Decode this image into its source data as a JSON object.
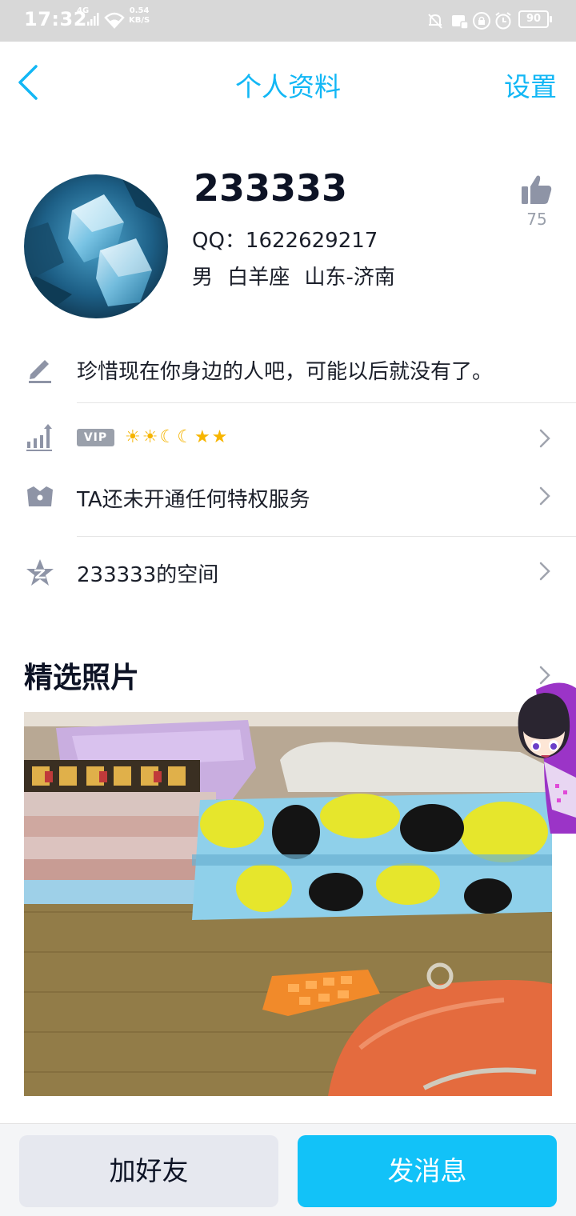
{
  "status_bar": {
    "time": "17:32",
    "network": "4G",
    "speed_value": "0.54",
    "speed_unit": "KB/S",
    "battery": "90",
    "icons": [
      "signal-icon",
      "wifi-icon",
      "mute-icon",
      "sim-icon",
      "lock-icon",
      "alarm-icon",
      "battery-icon"
    ]
  },
  "header": {
    "title": "个人资料",
    "settings_label": "设置",
    "back_icon": "chevron-left-icon"
  },
  "profile": {
    "nickname": "233333",
    "qq_label": "QQ：1622629217",
    "meta": "男  白羊座  山东-济南",
    "likes": "75"
  },
  "rows": {
    "signature": "珍惜现在你身边的人吧，可能以后就没有了。",
    "vip_badge": "VIP",
    "level_icons": [
      "sun",
      "sun",
      "moon",
      "moon",
      "star",
      "star"
    ],
    "privilege": "TA还未开通任何特权服务",
    "qzone": "233333的空间"
  },
  "photos": {
    "section_title": "精选照片"
  },
  "bottom": {
    "add_friend": "加好友",
    "send_message": "发消息"
  },
  "colors": {
    "accent": "#12b7f5",
    "primary_button": "#12c2f8",
    "secondary_button": "#e6e8ef",
    "icon_gray": "#8e94a6"
  }
}
